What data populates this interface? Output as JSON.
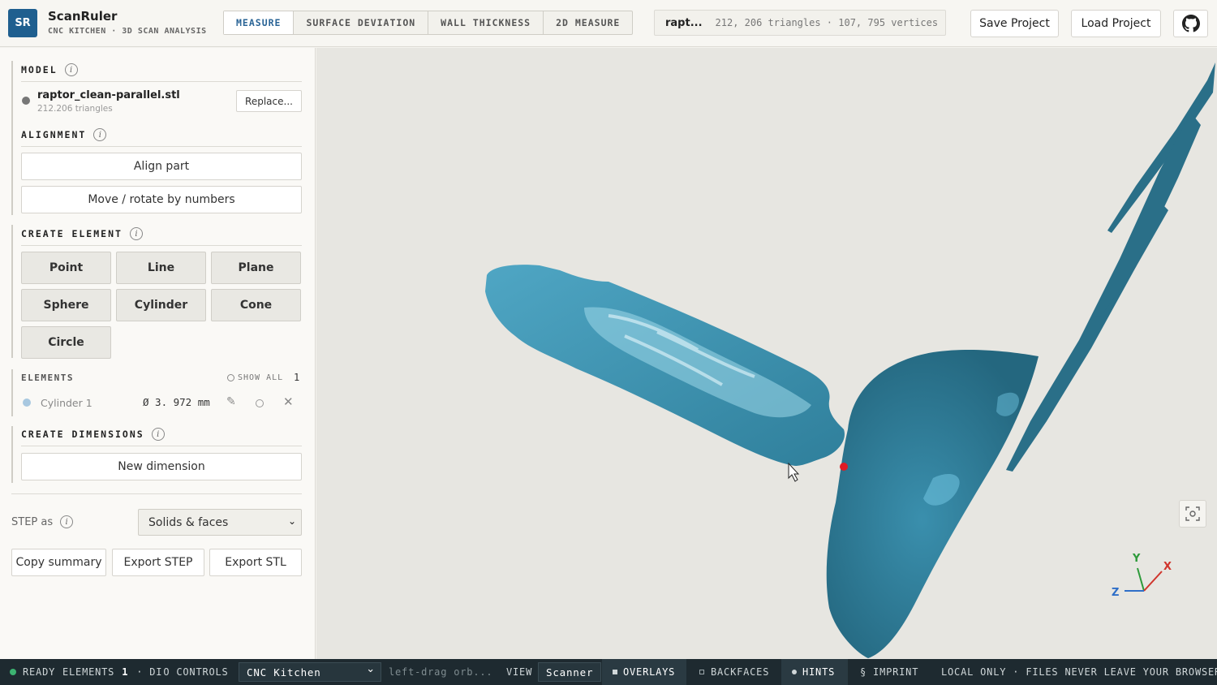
{
  "app": {
    "logo": "SR",
    "title": "ScanRuler",
    "subtitle": "CNC KITCHEN · 3D SCAN ANALYSIS"
  },
  "tabs": [
    {
      "label": "MEASURE",
      "active": true
    },
    {
      "label": "SURFACE DEVIATION",
      "active": false
    },
    {
      "label": "WALL THICKNESS",
      "active": false
    },
    {
      "label": "2D MEASURE",
      "active": false
    }
  ],
  "file_info": {
    "short_name": "rapt...",
    "stats": "212, 206 triangles · 107, 795 vertices"
  },
  "header_buttons": {
    "save": "Save Project",
    "load": "Load Project",
    "github_icon": "github-icon"
  },
  "sidebar": {
    "model": {
      "title": "MODEL",
      "file_name": "raptor_clean-parallel.stl",
      "triangles": "212.206 triangles",
      "replace": "Replace..."
    },
    "alignment": {
      "title": "ALIGNMENT",
      "align_part": "Align part",
      "move_rotate": "Move / rotate by numbers"
    },
    "create_element": {
      "title": "CREATE ELEMENT",
      "buttons": [
        "Point",
        "Line",
        "Plane",
        "Sphere",
        "Cylinder",
        "Cone",
        "Circle"
      ]
    },
    "elements": {
      "title": "ELEMENTS",
      "show_all": "SHOW ALL",
      "count": "1",
      "items": [
        {
          "name": "Cylinder 1",
          "value": "Ø 3. 972 mm",
          "dot_color": "#a8c8e0"
        }
      ]
    },
    "create_dimensions": {
      "title": "CREATE DIMENSIONS",
      "new_dimension": "New dimension"
    },
    "step": {
      "label": "STEP as",
      "selected": "Solids & faces"
    },
    "actions": {
      "copy_summary": "Copy summary",
      "export_step": "Export STEP",
      "export_stl": "Export STL"
    }
  },
  "viewport": {
    "model_color": "#2f7f9b",
    "axes": {
      "x": "X",
      "y": "Y",
      "z": "Z"
    }
  },
  "statusbar": {
    "ready": "READY",
    "elements": "ELEMENTS",
    "elements_count": "1",
    "dimensions_partial": "DI",
    "controls_partial": "O CONTROLS",
    "controls_value": "CNC Kitchen",
    "hint": "left-drag orb...",
    "view_label": "VIEW",
    "view_value": "Scanner b",
    "overlays": "OVERLAYS",
    "backfaces": "BACKFACES",
    "hints": "HINTS",
    "imprint": "§ IMPRINT",
    "privacy": "LOCAL ONLY · FILES NEVER LEAVE YOUR BROWSER"
  }
}
